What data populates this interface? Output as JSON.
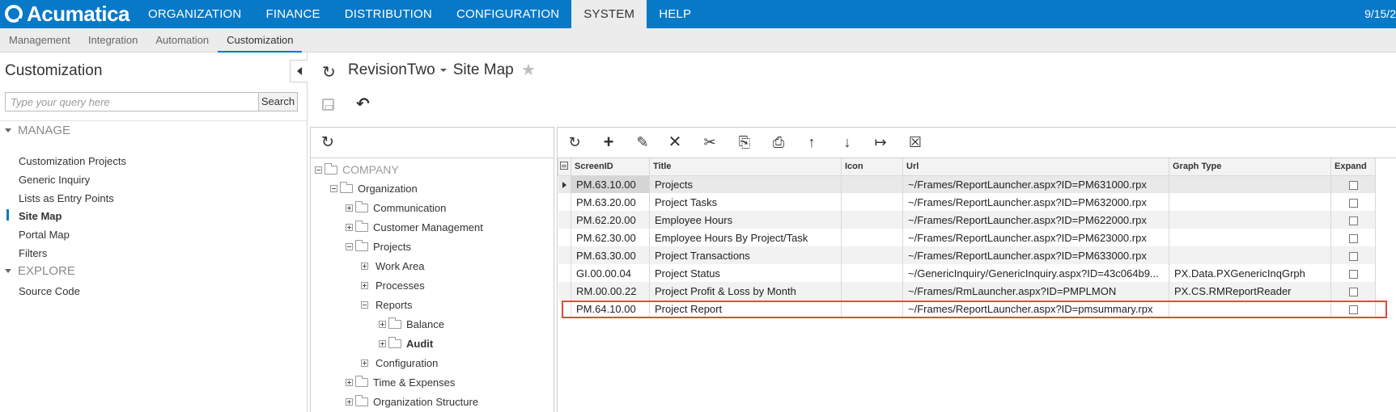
{
  "app": {
    "logo": "Acumatica",
    "modules": [
      "ORGANIZATION",
      "FINANCE",
      "DISTRIBUTION",
      "CONFIGURATION",
      "SYSTEM",
      "HELP"
    ],
    "active_module": "SYSTEM",
    "date": "9/15/2"
  },
  "subnav": {
    "tabs": [
      "Management",
      "Integration",
      "Automation",
      "Customization"
    ],
    "active_tab": "Customization"
  },
  "sidebar": {
    "title": "Customization",
    "search_placeholder": "Type your query here",
    "search_button": "Search",
    "sections": [
      {
        "label": "MANAGE",
        "items": [
          "Customization Projects",
          "Generic Inquiry",
          "Lists as Entry Points",
          "Site Map",
          "Portal Map",
          "Filters"
        ]
      },
      {
        "label": "EXPLORE",
        "items": [
          "Source Code"
        ]
      }
    ],
    "active_item": "Site Map"
  },
  "page": {
    "project": "RevisionTwo",
    "title": "Site Map"
  },
  "tree": {
    "nodes": [
      {
        "label": "COMPANY"
      },
      {
        "label": "Organization"
      },
      {
        "label": "Communication"
      },
      {
        "label": "Customer Management"
      },
      {
        "label": "Projects"
      },
      {
        "label": "Work Area"
      },
      {
        "label": "Processes"
      },
      {
        "label": "Reports"
      },
      {
        "label": "Balance"
      },
      {
        "label": "Audit"
      },
      {
        "label": "Configuration"
      },
      {
        "label": "Time & Expenses"
      },
      {
        "label": "Organization Structure"
      }
    ]
  },
  "grid": {
    "toolbar_icons": [
      "refresh-icon",
      "add-icon",
      "edit-icon",
      "delete-icon",
      "cut-icon",
      "copy-icon",
      "paste-icon",
      "move-up-icon",
      "move-down-icon",
      "fit-columns-icon",
      "export-excel-icon"
    ],
    "columns": [
      "ScreenID",
      "Title",
      "Icon",
      "Url",
      "Graph Type",
      "Expand"
    ],
    "rows": [
      {
        "screen_id": "PM.63.10.00",
        "title": "Projects",
        "icon": "",
        "url": "~/Frames/ReportLauncher.aspx?ID=PM631000.rpx",
        "graph_type": ""
      },
      {
        "screen_id": "PM.63.20.00",
        "title": "Project Tasks",
        "icon": "",
        "url": "~/Frames/ReportLauncher.aspx?ID=PM632000.rpx",
        "graph_type": ""
      },
      {
        "screen_id": "PM.62.20.00",
        "title": "Employee Hours",
        "icon": "",
        "url": "~/Frames/ReportLauncher.aspx?ID=PM622000.rpx",
        "graph_type": ""
      },
      {
        "screen_id": "PM.62.30.00",
        "title": "Employee Hours By Project/Task",
        "icon": "",
        "url": "~/Frames/ReportLauncher.aspx?ID=PM623000.rpx",
        "graph_type": ""
      },
      {
        "screen_id": "PM.63.30.00",
        "title": "Project Transactions",
        "icon": "",
        "url": "~/Frames/ReportLauncher.aspx?ID=PM633000.rpx",
        "graph_type": ""
      },
      {
        "screen_id": "GI.00.00.04",
        "title": "Project Status",
        "icon": "",
        "url": "~/GenericInquiry/GenericInquiry.aspx?ID=43c064b9...",
        "graph_type": "PX.Data.PXGenericInqGrph"
      },
      {
        "screen_id": "RM.00.00.22",
        "title": "Project Profit & Loss by Month",
        "icon": "",
        "url": "~/Frames/RmLauncher.aspx?ID=PMPLMON",
        "graph_type": "PX.CS.RMReportReader"
      },
      {
        "screen_id": "PM.64.10.00",
        "title": "Project Report",
        "icon": "",
        "url": "~/Frames/ReportLauncher.aspx?ID=pmsummary.rpx",
        "graph_type": ""
      }
    ]
  },
  "colors": {
    "topbar": "#0779c7",
    "highlight_border": "#e04a3c"
  }
}
